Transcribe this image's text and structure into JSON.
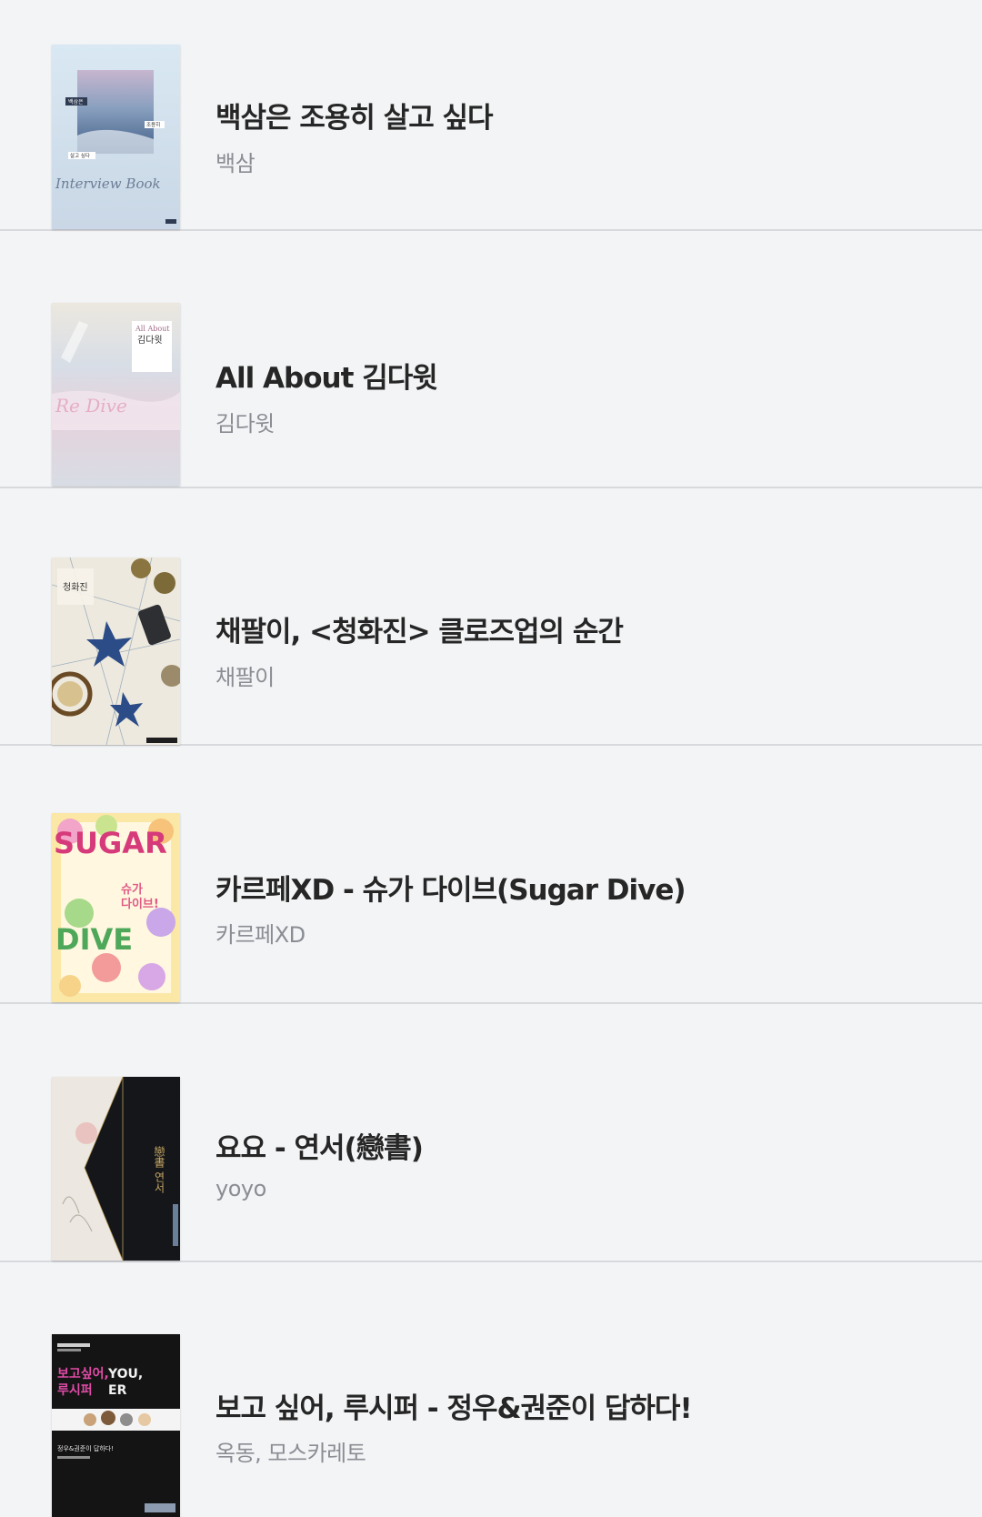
{
  "books": [
    {
      "title": "백삼은 조용히 살고 싶다",
      "author": "백삼",
      "cover_icon": "book-cover-interview-sky",
      "cover_text": [
        "백삼은",
        "조용히",
        "살고 싶다",
        "Interview Book"
      ]
    },
    {
      "title": "All About 김다윗",
      "author": "김다윗",
      "cover_icon": "book-cover-pastel-sea",
      "cover_text": [
        "All About",
        "김다윗"
      ]
    },
    {
      "title": "채팔이, <청화진> 클로즈업의 순간",
      "author": "채팔이",
      "cover_icon": "book-cover-map-flowers",
      "cover_text": [
        "청화진"
      ]
    },
    {
      "title": "카르페XD - 슈가 다이브(Sugar Dive)",
      "author": "카르페XD",
      "cover_icon": "book-cover-candy-hearts",
      "cover_text": [
        "SUGAR",
        "DIVE",
        "슈가",
        "다이브!"
      ]
    },
    {
      "title": "요요 - 연서(戀書)",
      "author": "yoyo",
      "cover_icon": "book-cover-black-white",
      "cover_text": [
        "戀書",
        "연서"
      ]
    },
    {
      "title": "보고 싶어, 루시퍼 - 정우&권준이 답하다!",
      "author": "옥동, 모스카레토",
      "cover_icon": "book-cover-pixel-dark",
      "cover_text": [
        "보고싶어,",
        "루시퍼",
        "YOU,",
        "ER",
        "정우&권준이 답하다!"
      ]
    }
  ],
  "colors": {
    "background": "#f3f4f6",
    "divider": "#d7d9dd",
    "title": "#262626",
    "author": "#8a8d93"
  }
}
